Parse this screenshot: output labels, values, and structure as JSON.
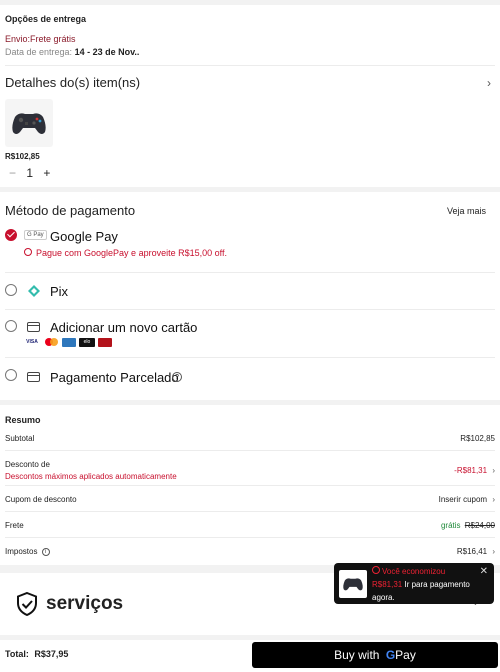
{
  "delivery": {
    "title": "Opções de entrega",
    "shipping": "Envio:Frete grátis",
    "date_label": "Data de entrega:",
    "date_value": "14 - 23 de Nov.."
  },
  "items": {
    "title": "Detalhes do(s) item(ns)",
    "price": "R$102,85",
    "quantity": "1",
    "minus": "−",
    "plus": "+"
  },
  "payment": {
    "title": "Método de pagamento",
    "see_more": "Veja mais",
    "googlepay_badge": "G Pay",
    "googlepay_label": "Google Pay",
    "googlepay_promo": "Pague com GooglePay e aproveite R$15,00 off.",
    "pix_label": "Pix",
    "card_label": "Adicionar um novo cartão",
    "card_brands": [
      "VISA",
      "MC",
      "AMEX",
      "elo",
      "HC"
    ],
    "installments_label": "Pagamento Parcelado"
  },
  "summary": {
    "title": "Resumo",
    "subtotal_label": "Subtotal",
    "subtotal_value": "R$102,85",
    "discount_label": "Desconto de",
    "discount_sub": "Descontos máximos aplicados automaticamente",
    "discount_value": "-R$81,31",
    "coupon_label": "Cupom de desconto",
    "coupon_value": "Inserir cupom",
    "shipping_label": "Frete",
    "shipping_free": "grátis",
    "shipping_old": "R$24,00",
    "taxes_label": "Impostos",
    "taxes_value": "R$16,41"
  },
  "services": {
    "title": "serviços"
  },
  "toast": {
    "title": "Você economizou",
    "amount": "R$81,31",
    "message_rest": "Ir para pagamento",
    "message_line2": "agora."
  },
  "footer": {
    "total_label": "Total:",
    "total_value": "R$37,95",
    "buy_label": "Buy with",
    "buy_brand": "Pay"
  },
  "colors": {
    "accent": "#c8102e",
    "green": "#1f8a3a",
    "dark": "#111111"
  }
}
